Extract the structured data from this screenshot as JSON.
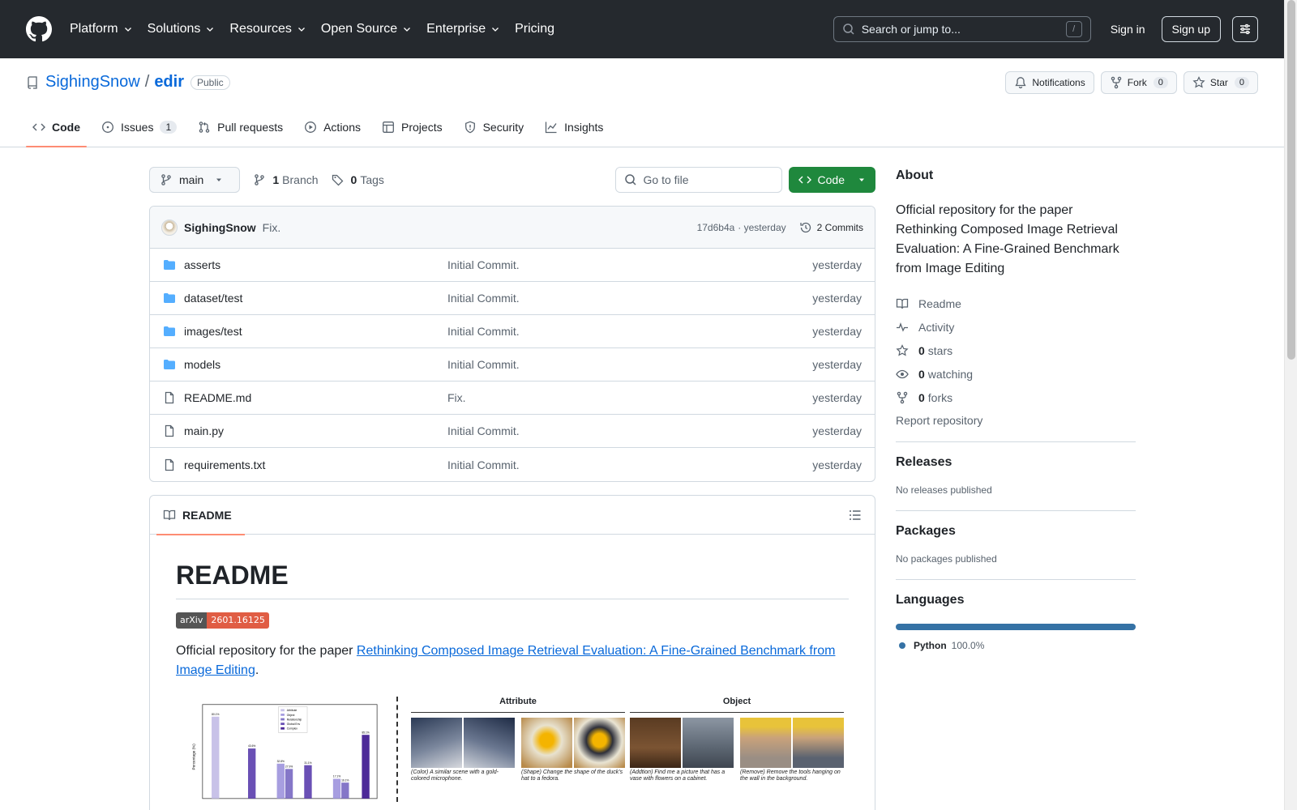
{
  "header": {
    "nav": [
      {
        "label": "Platform",
        "has_dropdown": true
      },
      {
        "label": "Solutions",
        "has_dropdown": true
      },
      {
        "label": "Resources",
        "has_dropdown": true
      },
      {
        "label": "Open Source",
        "has_dropdown": true
      },
      {
        "label": "Enterprise",
        "has_dropdown": true
      },
      {
        "label": "Pricing",
        "has_dropdown": false
      }
    ],
    "search_placeholder": "Search or jump to...",
    "search_key": "/",
    "signin_label": "Sign in",
    "signup_label": "Sign up"
  },
  "repo": {
    "owner": "SighingSnow",
    "separator": "/",
    "name": "edir",
    "visibility": "Public",
    "actions": {
      "notifications_label": "Notifications",
      "fork_label": "Fork",
      "fork_count": "0",
      "star_label": "Star",
      "star_count": "0"
    },
    "tabs": [
      {
        "label": "Code",
        "icon": "code-icon",
        "active": true,
        "count": ""
      },
      {
        "label": "Issues",
        "icon": "issue-icon",
        "active": false,
        "count": "1"
      },
      {
        "label": "Pull requests",
        "icon": "pull-request-icon",
        "active": false,
        "count": ""
      },
      {
        "label": "Actions",
        "icon": "play-icon",
        "active": false,
        "count": ""
      },
      {
        "label": "Projects",
        "icon": "table-icon",
        "active": false,
        "count": ""
      },
      {
        "label": "Security",
        "icon": "shield-icon",
        "active": false,
        "count": ""
      },
      {
        "label": "Insights",
        "icon": "graph-icon",
        "active": false,
        "count": ""
      }
    ]
  },
  "toolbar": {
    "branch": "main",
    "branch_count": "1",
    "branch_label": "Branch",
    "tag_count": "0",
    "tag_label": "Tags",
    "goto_placeholder": "Go to file",
    "code_label": "Code"
  },
  "commit": {
    "author": "SighingSnow",
    "message": "Fix.",
    "hash": "17d6b4a",
    "time": "· yesterday",
    "commits_label": "2 Commits"
  },
  "files": [
    {
      "name": "asserts",
      "type": "dir",
      "message": "Initial Commit.",
      "date": "yesterday"
    },
    {
      "name": "dataset/test",
      "type": "dir",
      "message": "Initial Commit.",
      "date": "yesterday"
    },
    {
      "name": "images/test",
      "type": "dir",
      "message": "Initial Commit.",
      "date": "yesterday"
    },
    {
      "name": "models",
      "type": "dir",
      "message": "Initial Commit.",
      "date": "yesterday"
    },
    {
      "name": "README.md",
      "type": "file",
      "message": "Fix.",
      "date": "yesterday"
    },
    {
      "name": "main.py",
      "type": "file",
      "message": "Initial Commit.",
      "date": "yesterday"
    },
    {
      "name": "requirements.txt",
      "type": "file",
      "message": "Initial Commit.",
      "date": "yesterday"
    }
  ],
  "readme": {
    "tab_label": "README",
    "heading": "README",
    "badge_left": "arXiv",
    "badge_right": "2601.16125",
    "intro_text": "Official repository for the paper ",
    "paper_link": "Rethinking Composed Image Retrieval Evaluation: A Fine-Grained Benchmark from Image Editing",
    "intro_end": ".",
    "figure": {
      "legend": [
        "Attribute",
        "Object",
        "Relationship",
        "Global Env",
        "Complex"
      ],
      "ylabel": "Percentage (%)",
      "bar_labels": [
        "80.1%",
        "43.6%",
        "32.8%",
        "27.9%",
        "31.1%",
        "17.1%",
        "16.1%",
        "85.1%"
      ],
      "group_titles": [
        "Attribute",
        "Object"
      ],
      "captions": [
        "(Color) A similar scene with a gold-colored microphone.",
        "(Shape) Change the shape of the duck's hat to a fedora.",
        "(Addtion) Find me a picture that has a vase with flowers on a cabinet.",
        "(Remove) Remove the tools hanging on the wall in the background."
      ]
    }
  },
  "about": {
    "title": "About",
    "description": "Official repository for the paper Rethinking Composed Image Retrieval Evaluation: A Fine-Grained Benchmark from Image Editing",
    "items": [
      {
        "icon": "book-icon",
        "count": "",
        "label": "Readme"
      },
      {
        "icon": "pulse-icon",
        "count": "",
        "label": "Activity"
      },
      {
        "icon": "star-icon",
        "count": "0",
        "label": "stars"
      },
      {
        "icon": "eye-icon",
        "count": "0",
        "label": "watching"
      },
      {
        "icon": "fork-icon",
        "count": "0",
        "label": "forks"
      }
    ],
    "report_label": "Report repository"
  },
  "releases": {
    "title": "Releases",
    "empty": "No releases published"
  },
  "packages": {
    "title": "Packages",
    "empty": "No packages published"
  },
  "languages": {
    "title": "Languages",
    "items": [
      {
        "name": "Python",
        "percent": "100.0%",
        "color": "#3572a5"
      }
    ]
  },
  "colors": {
    "link": "#0969da",
    "header_bg": "#25292e",
    "code_button": "#1f883d",
    "active_tab": "#fd8c73"
  }
}
